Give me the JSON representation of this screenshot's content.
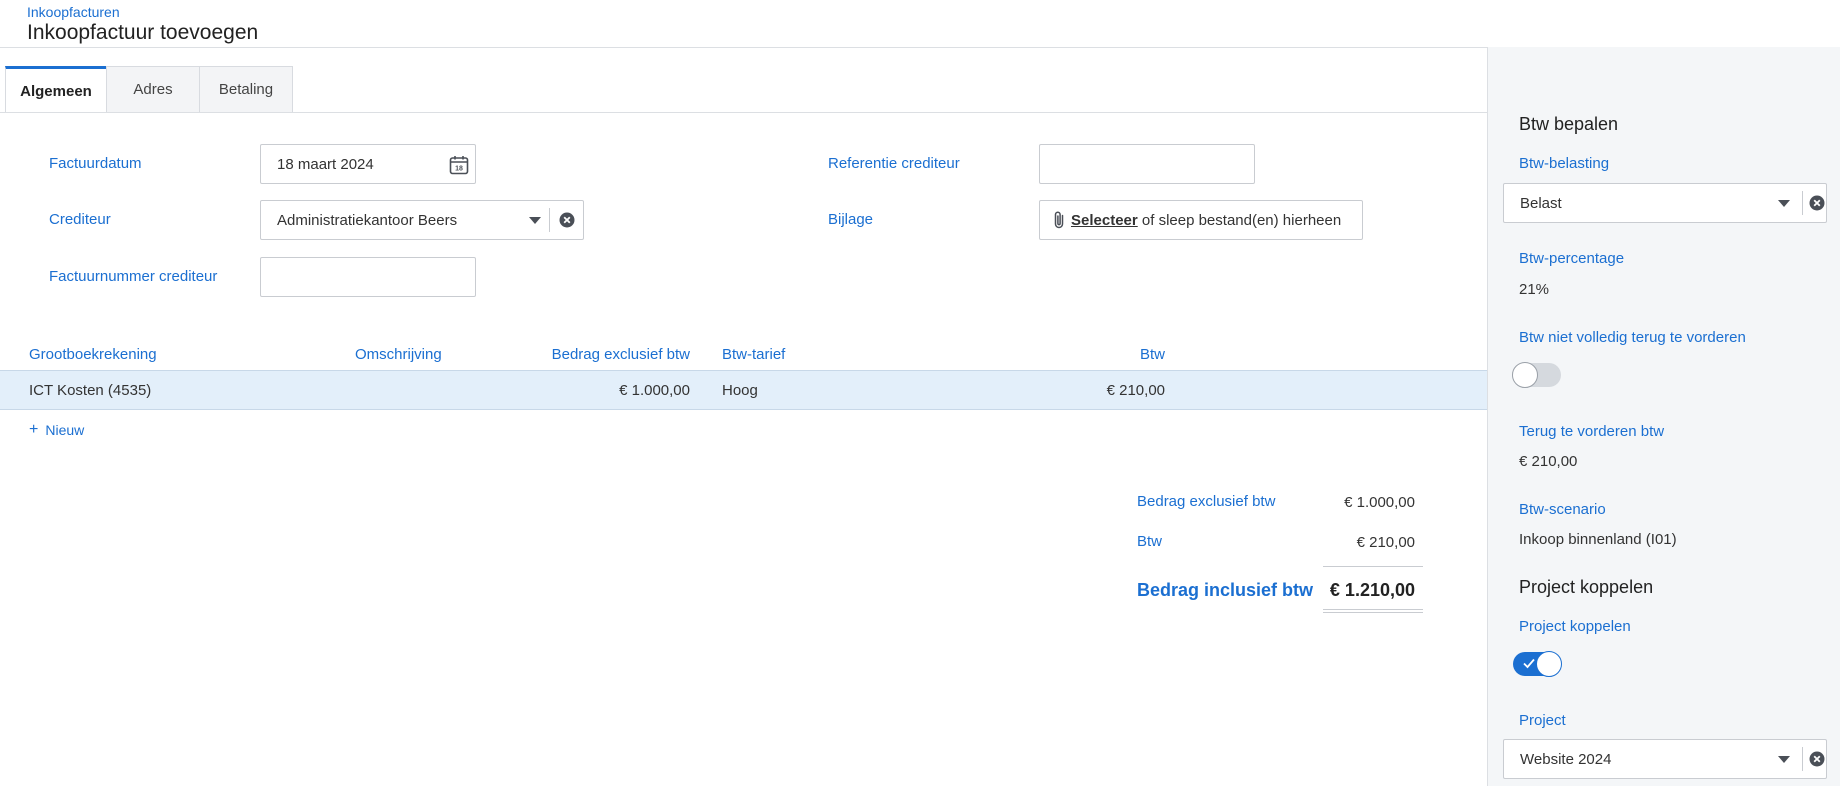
{
  "header": {
    "breadcrumb": "Inkoopfacturen",
    "title": "Inkoopfactuur toevoegen"
  },
  "tabs": [
    {
      "label": "Algemeen",
      "active": true
    },
    {
      "label": "Adres",
      "active": false
    },
    {
      "label": "Betaling",
      "active": false
    }
  ],
  "form": {
    "factuurdatum": {
      "label": "Factuurdatum",
      "value": "18 maart 2024",
      "calendar_day": "18"
    },
    "crediteur": {
      "label": "Crediteur",
      "value": "Administratiekantoor Beers"
    },
    "factuurnummer": {
      "label": "Factuurnummer crediteur",
      "value": ""
    },
    "referentie": {
      "label": "Referentie crediteur",
      "value": ""
    },
    "bijlage": {
      "label": "Bijlage",
      "link": "Selecteer",
      "text": " of sleep bestand(en) hierheen"
    }
  },
  "table": {
    "headers": [
      "Grootboekrekening",
      "Omschrijving",
      "Bedrag exclusief btw",
      "Btw-tarief",
      "Btw"
    ],
    "rows": [
      {
        "grootboekrekening": "ICT Kosten (4535)",
        "omschrijving": "",
        "bedrag": "€ 1.000,00",
        "tarief": "Hoog",
        "btw": "€ 210,00"
      }
    ],
    "new_label": "Nieuw"
  },
  "totals": {
    "excl_label": "Bedrag exclusief btw",
    "excl_value": "€ 1.000,00",
    "btw_label": "Btw",
    "btw_value": "€ 210,00",
    "incl_label": "Bedrag inclusief btw",
    "incl_value": "€ 1.210,00"
  },
  "panel": {
    "btw_heading": "Btw bepalen",
    "belasting_label": "Btw-belasting",
    "belasting_value": "Belast",
    "percentage_label": "Btw-percentage",
    "percentage_value": "21%",
    "niet_volledig_label": "Btw niet volledig terug te vorderen",
    "niet_volledig_on": false,
    "terug_label": "Terug te vorderen btw",
    "terug_value": "€ 210,00",
    "scenario_label": "Btw-scenario",
    "scenario_value": "Inkoop binnenland (I01)",
    "project_heading": "Project koppelen",
    "project_koppelen_label": "Project koppelen",
    "project_koppelen_on": true,
    "project_label": "Project",
    "project_value": "Website 2024"
  },
  "colors": {
    "accent": "#1b6fd1",
    "row_highlight": "#e3effa",
    "panel_bg": "#f4f6f8"
  }
}
